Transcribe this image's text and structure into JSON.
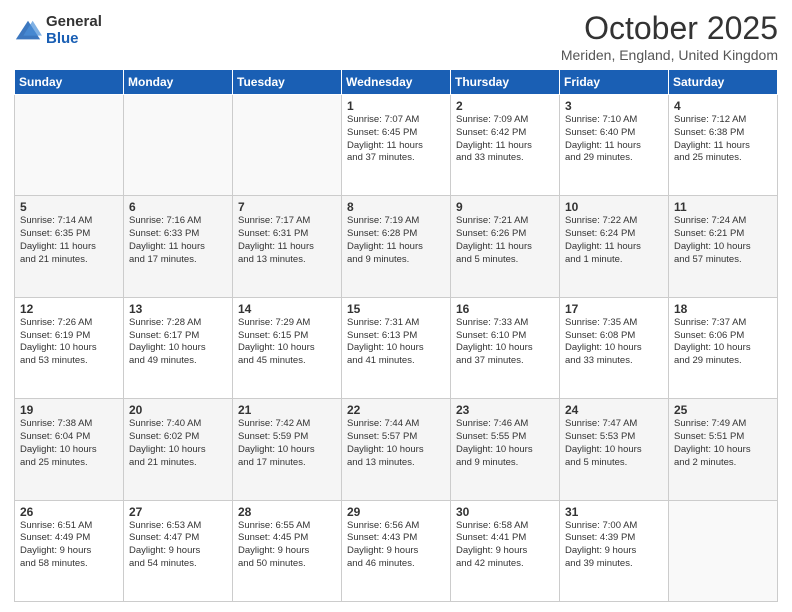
{
  "logo": {
    "general": "General",
    "blue": "Blue"
  },
  "title": "October 2025",
  "location": "Meriden, England, United Kingdom",
  "days_of_week": [
    "Sunday",
    "Monday",
    "Tuesday",
    "Wednesday",
    "Thursday",
    "Friday",
    "Saturday"
  ],
  "weeks": [
    [
      {
        "day": "",
        "info": ""
      },
      {
        "day": "",
        "info": ""
      },
      {
        "day": "",
        "info": ""
      },
      {
        "day": "1",
        "info": "Sunrise: 7:07 AM\nSunset: 6:45 PM\nDaylight: 11 hours\nand 37 minutes."
      },
      {
        "day": "2",
        "info": "Sunrise: 7:09 AM\nSunset: 6:42 PM\nDaylight: 11 hours\nand 33 minutes."
      },
      {
        "day": "3",
        "info": "Sunrise: 7:10 AM\nSunset: 6:40 PM\nDaylight: 11 hours\nand 29 minutes."
      },
      {
        "day": "4",
        "info": "Sunrise: 7:12 AM\nSunset: 6:38 PM\nDaylight: 11 hours\nand 25 minutes."
      }
    ],
    [
      {
        "day": "5",
        "info": "Sunrise: 7:14 AM\nSunset: 6:35 PM\nDaylight: 11 hours\nand 21 minutes."
      },
      {
        "day": "6",
        "info": "Sunrise: 7:16 AM\nSunset: 6:33 PM\nDaylight: 11 hours\nand 17 minutes."
      },
      {
        "day": "7",
        "info": "Sunrise: 7:17 AM\nSunset: 6:31 PM\nDaylight: 11 hours\nand 13 minutes."
      },
      {
        "day": "8",
        "info": "Sunrise: 7:19 AM\nSunset: 6:28 PM\nDaylight: 11 hours\nand 9 minutes."
      },
      {
        "day": "9",
        "info": "Sunrise: 7:21 AM\nSunset: 6:26 PM\nDaylight: 11 hours\nand 5 minutes."
      },
      {
        "day": "10",
        "info": "Sunrise: 7:22 AM\nSunset: 6:24 PM\nDaylight: 11 hours\nand 1 minute."
      },
      {
        "day": "11",
        "info": "Sunrise: 7:24 AM\nSunset: 6:21 PM\nDaylight: 10 hours\nand 57 minutes."
      }
    ],
    [
      {
        "day": "12",
        "info": "Sunrise: 7:26 AM\nSunset: 6:19 PM\nDaylight: 10 hours\nand 53 minutes."
      },
      {
        "day": "13",
        "info": "Sunrise: 7:28 AM\nSunset: 6:17 PM\nDaylight: 10 hours\nand 49 minutes."
      },
      {
        "day": "14",
        "info": "Sunrise: 7:29 AM\nSunset: 6:15 PM\nDaylight: 10 hours\nand 45 minutes."
      },
      {
        "day": "15",
        "info": "Sunrise: 7:31 AM\nSunset: 6:13 PM\nDaylight: 10 hours\nand 41 minutes."
      },
      {
        "day": "16",
        "info": "Sunrise: 7:33 AM\nSunset: 6:10 PM\nDaylight: 10 hours\nand 37 minutes."
      },
      {
        "day": "17",
        "info": "Sunrise: 7:35 AM\nSunset: 6:08 PM\nDaylight: 10 hours\nand 33 minutes."
      },
      {
        "day": "18",
        "info": "Sunrise: 7:37 AM\nSunset: 6:06 PM\nDaylight: 10 hours\nand 29 minutes."
      }
    ],
    [
      {
        "day": "19",
        "info": "Sunrise: 7:38 AM\nSunset: 6:04 PM\nDaylight: 10 hours\nand 25 minutes."
      },
      {
        "day": "20",
        "info": "Sunrise: 7:40 AM\nSunset: 6:02 PM\nDaylight: 10 hours\nand 21 minutes."
      },
      {
        "day": "21",
        "info": "Sunrise: 7:42 AM\nSunset: 5:59 PM\nDaylight: 10 hours\nand 17 minutes."
      },
      {
        "day": "22",
        "info": "Sunrise: 7:44 AM\nSunset: 5:57 PM\nDaylight: 10 hours\nand 13 minutes."
      },
      {
        "day": "23",
        "info": "Sunrise: 7:46 AM\nSunset: 5:55 PM\nDaylight: 10 hours\nand 9 minutes."
      },
      {
        "day": "24",
        "info": "Sunrise: 7:47 AM\nSunset: 5:53 PM\nDaylight: 10 hours\nand 5 minutes."
      },
      {
        "day": "25",
        "info": "Sunrise: 7:49 AM\nSunset: 5:51 PM\nDaylight: 10 hours\nand 2 minutes."
      }
    ],
    [
      {
        "day": "26",
        "info": "Sunrise: 6:51 AM\nSunset: 4:49 PM\nDaylight: 9 hours\nand 58 minutes."
      },
      {
        "day": "27",
        "info": "Sunrise: 6:53 AM\nSunset: 4:47 PM\nDaylight: 9 hours\nand 54 minutes."
      },
      {
        "day": "28",
        "info": "Sunrise: 6:55 AM\nSunset: 4:45 PM\nDaylight: 9 hours\nand 50 minutes."
      },
      {
        "day": "29",
        "info": "Sunrise: 6:56 AM\nSunset: 4:43 PM\nDaylight: 9 hours\nand 46 minutes."
      },
      {
        "day": "30",
        "info": "Sunrise: 6:58 AM\nSunset: 4:41 PM\nDaylight: 9 hours\nand 42 minutes."
      },
      {
        "day": "31",
        "info": "Sunrise: 7:00 AM\nSunset: 4:39 PM\nDaylight: 9 hours\nand 39 minutes."
      },
      {
        "day": "",
        "info": ""
      }
    ]
  ]
}
